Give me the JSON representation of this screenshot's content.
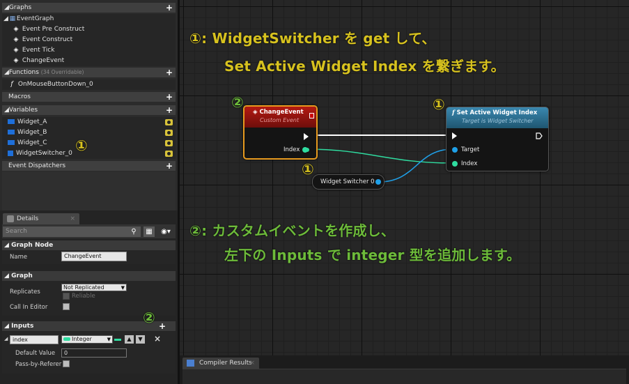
{
  "sidebar": {
    "graphs_header": "Graphs",
    "event_graph": "EventGraph",
    "events": [
      "Event Pre Construct",
      "Event Construct",
      "Event Tick",
      "ChangeEvent"
    ],
    "functions_header": "Functions",
    "functions_count": "(34 Overridable)",
    "function_items": [
      "OnMouseButtonDown_0"
    ],
    "macros_header": "Macros",
    "variables_header": "Variables",
    "variables": [
      "Widget_A",
      "Widget_B",
      "Widget_C",
      "WidgetSwitcher_0"
    ],
    "dispatchers_header": "Event Dispatchers",
    "plus": "+"
  },
  "details": {
    "tab_label": "Details",
    "tab_close": "×",
    "search_placeholder": "Search",
    "graph_node_header": "Graph Node",
    "name_label": "Name",
    "name_value": "ChangeEvent",
    "graph_header": "Graph",
    "replicates_label": "Replicates",
    "replicates_value": "Not Replicated",
    "reliable_label": "Reliable",
    "call_in_editor_label": "Call In Editor",
    "inputs_header": "Inputs",
    "input_name": "index",
    "input_type": "Integer",
    "default_value_label": "Default Value",
    "default_value": "0",
    "pass_by_ref_label": "Pass-by-Referer",
    "remove": "×"
  },
  "compiler": {
    "tab_label": "Compiler Results",
    "tab_close": "×"
  },
  "graph": {
    "annotation1_line1": "①: WidgetSwitcher を get して、",
    "annotation1_line2": "Set Active Widget Index を繋ぎます。",
    "annotation2_line1": "②: カスタムイベントを作成し、",
    "annotation2_line2": "左下の Inputs で integer 型を追加します。",
    "badge1": "①",
    "badge2": "②",
    "event_node": {
      "title": "ChangeEvent",
      "subtitle": "Custom Event",
      "pin_index": "Index"
    },
    "set_node": {
      "title": "Set Active Widget Index",
      "subtitle": "Target is Widget Switcher",
      "pin_target": "Target",
      "pin_index": "Index"
    },
    "getter_node": {
      "label": "Widget Switcher 0"
    }
  },
  "colors": {
    "annotation_yellow": "#d7c21f",
    "annotation_green": "#6dbb3a",
    "event_red": "#a8140f",
    "function_blue": "#2f6f92",
    "object_pin": "#1fa0e8",
    "int_pin": "#2fdca0",
    "variable_blue": "#1e6fd9"
  }
}
